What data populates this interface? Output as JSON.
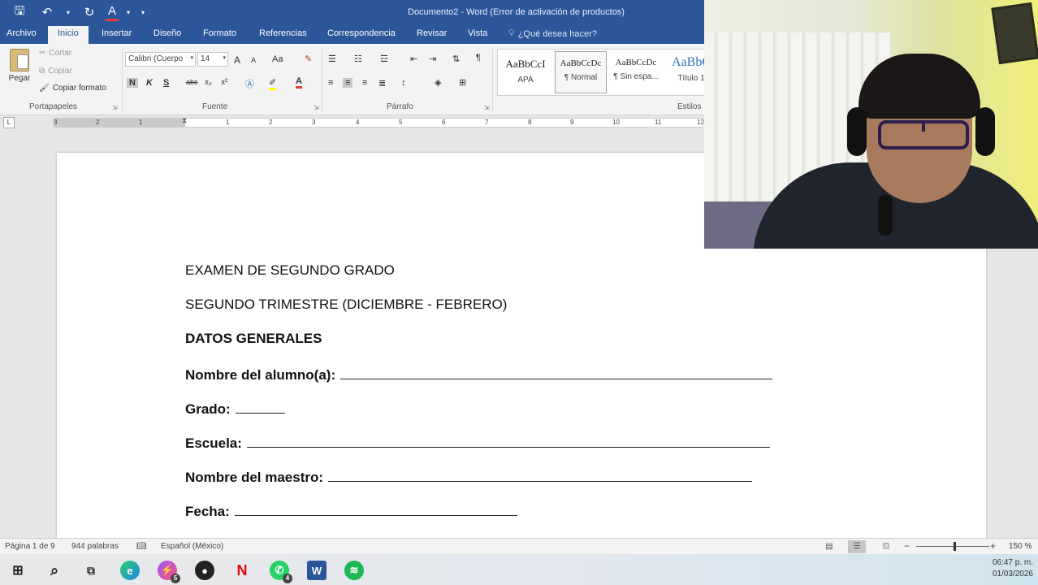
{
  "app": {
    "window_title": "Documento2 - Word (Error de activación de productos)"
  },
  "menu": {
    "tabs": [
      "Archivo",
      "Inicio",
      "Insertar",
      "Diseño",
      "Formato",
      "Referencias",
      "Correspondencia",
      "Revisar",
      "Vista"
    ],
    "active_tab": "Inicio",
    "tell_me": "¿Qué desea hacer?"
  },
  "ribbon": {
    "clipboard": {
      "paste": "Pegar",
      "cut": "Cortar",
      "copy": "Copiar",
      "format_painter": "Copiar formato",
      "label": "Portapapeles"
    },
    "font": {
      "name": "Calibri (Cuerpo",
      "size": "14",
      "label": "Fuente",
      "bold": "N",
      "italic": "K",
      "underline": "S",
      "strike": "abc",
      "subscript": "x₂",
      "superscript": "x²",
      "grow": "A",
      "shrink": "A",
      "case": "Aa",
      "font_color": "#e23a2e",
      "highlight_color": "#ffff00"
    },
    "paragraph": {
      "label": "Párrafo"
    },
    "styles": {
      "label": "Estilos",
      "items": [
        {
          "sample": "AaBbCcI",
          "name": "APA"
        },
        {
          "sample": "AaBbCcDc",
          "name": "¶ Normal"
        },
        {
          "sample": "AaBbCcDc",
          "name": "¶ Sin espa..."
        },
        {
          "sample": "AaBbC",
          "name": "Título 1"
        }
      ]
    }
  },
  "ruler": {
    "numbers": [
      "3",
      "2",
      "1",
      "1",
      "2",
      "3",
      "4",
      "5",
      "6",
      "7",
      "8",
      "9",
      "10",
      "11",
      "12"
    ]
  },
  "document": {
    "line1": "EXAMEN DE SEGUNDO GRADO",
    "line2": "SEGUNDO TRIMESTRE (DICIEMBRE - FEBRERO)",
    "line3": "DATOS GENERALES",
    "field_student": "Nombre del alumno(a):",
    "field_grade": "Grado:",
    "field_school": "Escuela:",
    "field_teacher": "Nombre del maestro:",
    "field_date": "Fecha:"
  },
  "status": {
    "page": "Página 1 de 9",
    "words": "944 palabras",
    "language": "Español (México)",
    "zoom": "150 %"
  },
  "taskbar": {
    "time": "06:47 p. m.",
    "date": "01/03/2026",
    "badges": {
      "messenger": "5",
      "whatsapp": "4"
    }
  }
}
